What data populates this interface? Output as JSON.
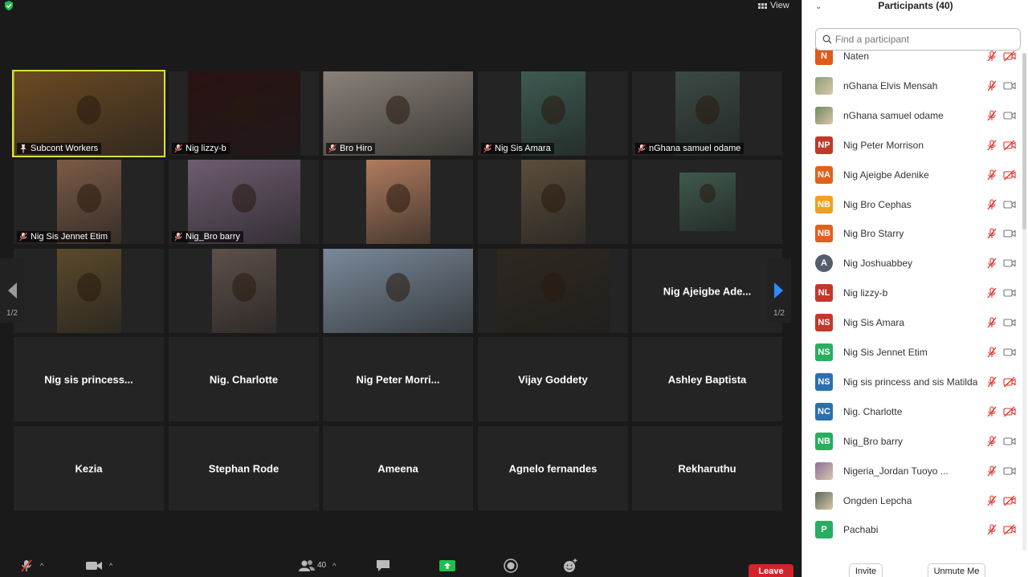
{
  "view_label": "View",
  "pager": {
    "page": "1/2"
  },
  "gallery": {
    "video_tiles": [
      {
        "name": "Subcont Workers",
        "mic": "pinned",
        "video_color": "#6b4a23",
        "video_width": 187,
        "active": true
      },
      {
        "name": "Nig lizzy-b",
        "mic": "muted",
        "video_color": "#2a1212",
        "video_width": 140
      },
      {
        "name": "Bro Hiro",
        "mic": "muted",
        "video_color": "#8a8179",
        "video_width": 187
      },
      {
        "name": "Nig Sis Amara",
        "mic": "muted",
        "video_color": "#3d5b52",
        "video_width": 80
      },
      {
        "name": "nGhana samuel odame",
        "mic": "muted",
        "video_color": "#3b4a44",
        "video_width": 80
      },
      {
        "name": "Nig Sis Jennet Etim",
        "mic": "muted",
        "video_color": "#7b5b47",
        "video_width": 80
      },
      {
        "name": "Nig_Bro barry",
        "mic": "muted",
        "video_color": "#6e5c70",
        "video_width": 140
      },
      {
        "name": "",
        "mic": "none",
        "video_color": "#b07c5e",
        "video_width": 80
      },
      {
        "name": "",
        "mic": "none",
        "video_color": "#5b4d3c",
        "video_width": 80
      },
      {
        "name": "",
        "mic": "none",
        "video_color": "#3f5a4d",
        "video_width": 70,
        "small": true
      },
      {
        "name": "",
        "mic": "none",
        "video_color": "#5b4a2c",
        "video_width": 80
      },
      {
        "name": "",
        "mic": "none",
        "video_color": "#5d5049",
        "video_width": 80
      },
      {
        "name": "",
        "mic": "none",
        "video_color": "#7a8a9a",
        "video_width": 187
      },
      {
        "name": "",
        "mic": "none",
        "video_color": "#2e2820",
        "video_width": 140
      }
    ],
    "name_tiles": [
      "Nig Ajeigbe Ade...",
      "Nig sis princess...",
      "Nig. Charlotte",
      "Nig  Peter Morri...",
      "Vijay Goddety",
      "Ashley Baptista",
      "Kezia",
      "Stephan Rode",
      "Ameena",
      "Agnelo fernandes",
      "Rekharuthu"
    ]
  },
  "toolbar": {
    "participants_count": "40",
    "leave_label": "Leave"
  },
  "panel": {
    "title": "Participants (40)",
    "search_placeholder": "Find a participant",
    "invite_label": "Invite",
    "unmute_me_label": "Unmute Me",
    "participants": [
      {
        "initials": "N",
        "name": "Naten",
        "color": "#e05a1a",
        "mic": "muted",
        "cam": "off"
      },
      {
        "initials": "",
        "name": "nGhana Elvis Mensah",
        "color": "#8aa27a",
        "photo": true,
        "mic": "muted",
        "cam": "on"
      },
      {
        "initials": "",
        "name": "nGhana samuel odame",
        "color": "#6f8b5f",
        "photo": true,
        "mic": "muted",
        "cam": "on"
      },
      {
        "initials": "NP",
        "name": "Nig  Peter Morrison",
        "color": "#c0392b",
        "mic": "muted",
        "cam": "off"
      },
      {
        "initials": "NA",
        "name": "Nig Ajeigbe Adenike",
        "color": "#e0621a",
        "mic": "muted",
        "cam": "off"
      },
      {
        "initials": "NB",
        "name": "Nig Bro Cephas",
        "color": "#f0a020",
        "mic": "muted",
        "cam": "on"
      },
      {
        "initials": "NB",
        "name": "Nig Bro Starry",
        "color": "#e0621a",
        "mic": "muted",
        "cam": "on"
      },
      {
        "initials": "A",
        "name": "Nig Joshuabbey",
        "color": "#555f6b",
        "mic": "muted",
        "cam": "on"
      },
      {
        "initials": "NL",
        "name": "Nig lizzy-b",
        "color": "#c0392b",
        "mic": "muted",
        "cam": "on"
      },
      {
        "initials": "NS",
        "name": "Nig Sis Amara",
        "color": "#c0392b",
        "mic": "muted",
        "cam": "on"
      },
      {
        "initials": "NS",
        "name": "Nig Sis Jennet Etim",
        "color": "#27ae60",
        "mic": "muted",
        "cam": "on"
      },
      {
        "initials": "NS",
        "name": "Nig sis princess and sis Matilda",
        "color": "#2a6fb0",
        "mic": "muted",
        "cam": "off"
      },
      {
        "initials": "NC",
        "name": "Nig. Charlotte",
        "color": "#2a6fb0",
        "mic": "muted",
        "cam": "off"
      },
      {
        "initials": "NB",
        "name": "Nig_Bro barry",
        "color": "#27ae60",
        "mic": "muted",
        "cam": "on"
      },
      {
        "initials": "",
        "name": "Nigeria_Jordan Tuoyo ...",
        "color": "#8a6f9a",
        "photo": true,
        "mic": "muted",
        "cam": "on"
      },
      {
        "initials": "",
        "name": "Ongden Lepcha",
        "color": "#5a6b5a",
        "photo": true,
        "mic": "muted",
        "cam": "off"
      },
      {
        "initials": "P",
        "name": "Pachabi",
        "color": "#27ae60",
        "mic": "muted",
        "cam": "off"
      }
    ]
  }
}
